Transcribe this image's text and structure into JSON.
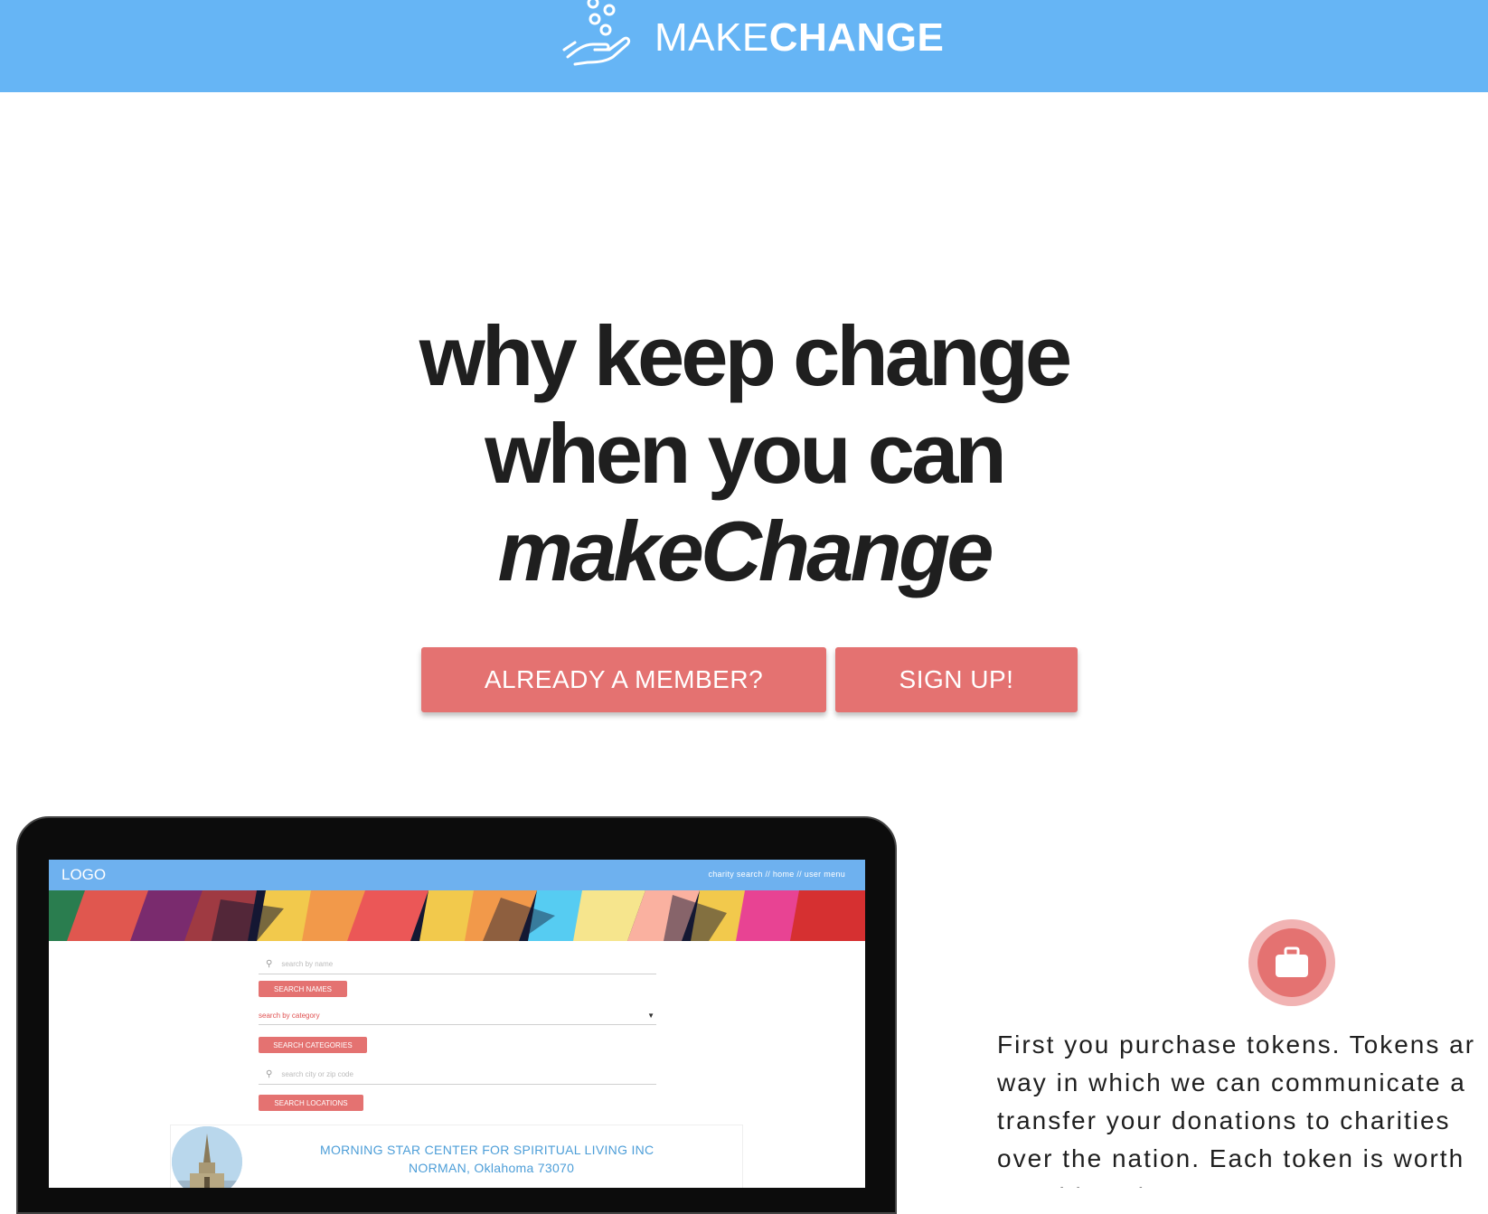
{
  "header": {
    "brand_light": "MAKE",
    "brand_bold": "CHANGE",
    "bg_color": "#66b5f5",
    "icon": "hand-coins-icon"
  },
  "hero": {
    "line1": "why keep change",
    "line2": "when you can",
    "line3": "makeChange"
  },
  "actions": {
    "member_label": "ALREADY A MEMBER?",
    "signup_label": "SIGN UP!",
    "button_color": "#e47271"
  },
  "mockup": {
    "logo": "LOGO",
    "nav_links": "charity search   //   home   //   user menu",
    "search_name_placeholder": "search by name",
    "search_names_btn": "SEARCH NAMES",
    "category_placeholder": "search by category",
    "search_categories_btn": "SEARCH CATEGORIES",
    "location_placeholder": "search city or zip code",
    "search_locations_btn": "SEARCH LOCATIONS",
    "result_name": "MORNING STAR CENTER FOR SPIRITUAL LIVING INC",
    "result_location": "NORMAN, Oklahoma 73070"
  },
  "feature": {
    "icon": "briefcase-icon",
    "line1": "First you purchase tokens. Tokens ar",
    "line2": "way in which we can communicate a",
    "line3": "transfer your donations to charities",
    "line4": "over the nation. Each token is worth",
    "line5": "...  Y                 l  k    \"                   \"  i"
  }
}
